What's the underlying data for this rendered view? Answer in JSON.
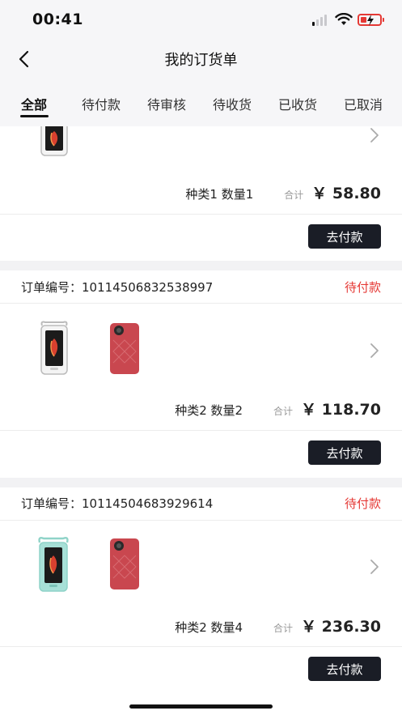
{
  "status_bar": {
    "time": "00:41"
  },
  "nav": {
    "title": "我的订货单"
  },
  "tabs": [
    {
      "label": "全部",
      "active": true
    },
    {
      "label": "待付款"
    },
    {
      "label": "待审核"
    },
    {
      "label": "待收货"
    },
    {
      "label": "已收货"
    },
    {
      "label": "已取消"
    }
  ],
  "orders": [
    {
      "summary": "种类1 数量1",
      "total_label": "合计",
      "price": "￥ 58.80",
      "button_label": "去付款",
      "products": [
        "waterproof-phone-pouch-white"
      ]
    },
    {
      "order_no": "订单编号：10114506832538997",
      "status": "待付款",
      "summary": "种类2 数量2",
      "total_label": "合计",
      "price": "￥ 118.70",
      "button_label": "去付款",
      "products": [
        "waterproof-phone-pouch-white",
        "red-phone-case"
      ]
    },
    {
      "order_no": "订单编号：10114504683929614",
      "status": "待付款",
      "summary": "种类2 数量4",
      "total_label": "合计",
      "price": "￥ 236.30",
      "button_label": "去付款",
      "products": [
        "waterproof-phone-pouch-teal",
        "red-phone-case"
      ]
    }
  ],
  "colors": {
    "accent": "#e53935",
    "button": "#1a1d26",
    "background": "#f2f2f4"
  }
}
